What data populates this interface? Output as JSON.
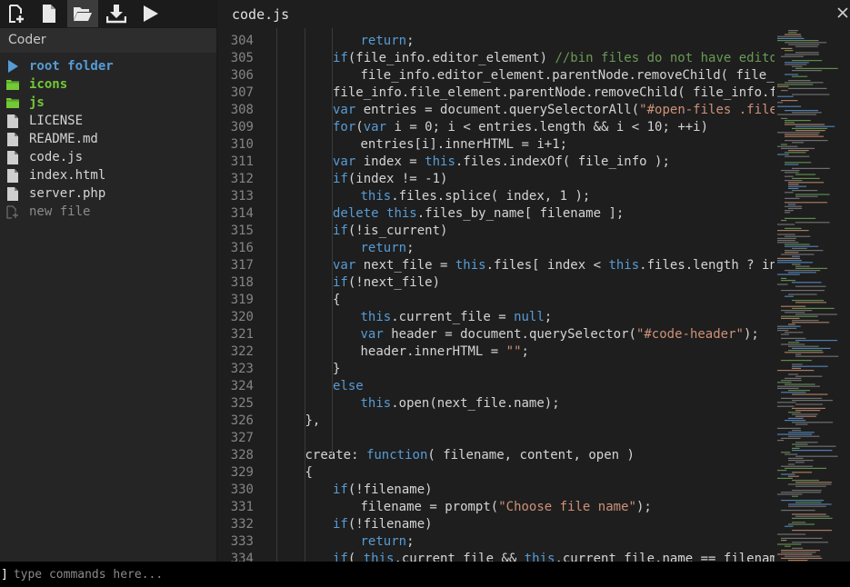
{
  "toolbar": {
    "buttons": [
      {
        "icon": "new-file-icon",
        "active": false
      },
      {
        "icon": "file-icon",
        "active": false
      },
      {
        "icon": "folder-open-icon",
        "active": true
      },
      {
        "icon": "download-icon",
        "active": false
      },
      {
        "icon": "play-icon",
        "active": false
      }
    ]
  },
  "sidebar": {
    "title": "Coder",
    "items": [
      {
        "label": "root folder",
        "type": "root",
        "icon": "triangle-right-icon"
      },
      {
        "label": "icons",
        "type": "folder",
        "icon": "folder-icon"
      },
      {
        "label": "js",
        "type": "folder",
        "icon": "folder-icon"
      },
      {
        "label": "LICENSE",
        "type": "file",
        "icon": "file-icon"
      },
      {
        "label": "README.md",
        "type": "file",
        "icon": "file-icon"
      },
      {
        "label": "code.js",
        "type": "file",
        "icon": "file-icon"
      },
      {
        "label": "index.html",
        "type": "file",
        "icon": "file-icon"
      },
      {
        "label": "server.php",
        "type": "file",
        "icon": "file-icon"
      },
      {
        "label": "new file",
        "type": "newfile",
        "icon": "new-file-icon"
      }
    ]
  },
  "editor": {
    "filename": "code.js",
    "lines": [
      {
        "n": "304",
        "indent": 3,
        "parts": [
          [
            "kw",
            "return"
          ],
          [
            "",
            "; "
          ]
        ]
      },
      {
        "n": "305",
        "indent": 2,
        "parts": [
          [
            "kw",
            "if"
          ],
          [
            "",
            "(file_info.editor_element) "
          ],
          [
            "cm",
            "//bin files do not have editor"
          ]
        ]
      },
      {
        "n": "306",
        "indent": 3,
        "parts": [
          [
            "",
            "file_info.editor_element.parentNode.removeChild( file_info."
          ]
        ]
      },
      {
        "n": "307",
        "indent": 2,
        "parts": [
          [
            "",
            "file_info.file_element.parentNode.removeChild( file_info.file_e"
          ]
        ]
      },
      {
        "n": "308",
        "indent": 2,
        "parts": [
          [
            "kw",
            "var"
          ],
          [
            "",
            " entries = document.querySelectorAll("
          ],
          [
            "str",
            "\"#open-files .filename"
          ]
        ]
      },
      {
        "n": "309",
        "indent": 2,
        "parts": [
          [
            "kw",
            "for"
          ],
          [
            "",
            "("
          ],
          [
            "kw",
            "var"
          ],
          [
            "",
            " i = 0; i < entries.length && i < 10; ++i)"
          ]
        ]
      },
      {
        "n": "310",
        "indent": 3,
        "parts": [
          [
            "",
            "entries[i].innerHTML = i+1;"
          ]
        ]
      },
      {
        "n": "311",
        "indent": 2,
        "parts": [
          [
            "kw",
            "var"
          ],
          [
            "",
            " index = "
          ],
          [
            "kw",
            "this"
          ],
          [
            "",
            ".files.indexOf( file_info );"
          ]
        ]
      },
      {
        "n": "312",
        "indent": 2,
        "parts": [
          [
            "kw",
            "if"
          ],
          [
            "",
            "(index != -1)"
          ]
        ]
      },
      {
        "n": "313",
        "indent": 3,
        "parts": [
          [
            "kw",
            "this"
          ],
          [
            "",
            ".files.splice( index, 1 );"
          ]
        ]
      },
      {
        "n": "314",
        "indent": 2,
        "parts": [
          [
            "kw",
            "delete"
          ],
          [
            "",
            " "
          ],
          [
            "kw",
            "this"
          ],
          [
            "",
            ".files_by_name[ filename ];"
          ]
        ]
      },
      {
        "n": "315",
        "indent": 2,
        "parts": [
          [
            "kw",
            "if"
          ],
          [
            "",
            "(!is_current)"
          ]
        ]
      },
      {
        "n": "316",
        "indent": 3,
        "parts": [
          [
            "kw",
            "return"
          ],
          [
            "",
            ";"
          ]
        ]
      },
      {
        "n": "317",
        "indent": 2,
        "parts": [
          [
            "kw",
            "var"
          ],
          [
            "",
            " next_file = "
          ],
          [
            "kw",
            "this"
          ],
          [
            "",
            ".files[ index < "
          ],
          [
            "kw",
            "this"
          ],
          [
            "",
            ".files.length ? index :"
          ]
        ]
      },
      {
        "n": "318",
        "indent": 2,
        "parts": [
          [
            "kw",
            "if"
          ],
          [
            "",
            "(!next_file)"
          ]
        ]
      },
      {
        "n": "319",
        "indent": 2,
        "parts": [
          [
            "",
            "{"
          ]
        ]
      },
      {
        "n": "320",
        "indent": 3,
        "parts": [
          [
            "kw",
            "this"
          ],
          [
            "",
            ".current_file = "
          ],
          [
            "kw",
            "null"
          ],
          [
            "",
            ";"
          ]
        ]
      },
      {
        "n": "321",
        "indent": 3,
        "parts": [
          [
            "kw",
            "var"
          ],
          [
            "",
            " header = document.querySelector("
          ],
          [
            "str",
            "\"#code-header\""
          ],
          [
            "",
            ");"
          ]
        ]
      },
      {
        "n": "322",
        "indent": 3,
        "parts": [
          [
            "",
            "header.innerHTML = "
          ],
          [
            "str",
            "\"\""
          ],
          [
            "",
            ";"
          ]
        ]
      },
      {
        "n": "323",
        "indent": 2,
        "parts": [
          [
            "",
            "}"
          ]
        ]
      },
      {
        "n": "324",
        "indent": 2,
        "parts": [
          [
            "kw",
            "else"
          ]
        ]
      },
      {
        "n": "325",
        "indent": 3,
        "parts": [
          [
            "kw",
            "this"
          ],
          [
            "",
            ".open(next_file.name);"
          ]
        ]
      },
      {
        "n": "326",
        "indent": 1,
        "parts": [
          [
            "",
            "},"
          ]
        ]
      },
      {
        "n": "327",
        "indent": 0,
        "parts": []
      },
      {
        "n": "328",
        "indent": 1,
        "parts": [
          [
            "",
            "create: "
          ],
          [
            "kw",
            "function"
          ],
          [
            "",
            "( filename, content, open )"
          ]
        ]
      },
      {
        "n": "329",
        "indent": 1,
        "parts": [
          [
            "",
            "{"
          ]
        ]
      },
      {
        "n": "330",
        "indent": 2,
        "parts": [
          [
            "kw",
            "if"
          ],
          [
            "",
            "(!filename)"
          ]
        ]
      },
      {
        "n": "331",
        "indent": 3,
        "parts": [
          [
            "",
            "filename = prompt("
          ],
          [
            "str",
            "\"Choose file name\""
          ],
          [
            "",
            ");"
          ]
        ]
      },
      {
        "n": "332",
        "indent": 2,
        "parts": [
          [
            "kw",
            "if"
          ],
          [
            "",
            "(!filename)"
          ]
        ]
      },
      {
        "n": "333",
        "indent": 3,
        "parts": [
          [
            "kw",
            "return"
          ],
          [
            "",
            ";"
          ]
        ]
      },
      {
        "n": "334",
        "indent": 2,
        "parts": [
          [
            "kw",
            "if"
          ],
          [
            "",
            "( "
          ],
          [
            "kw",
            "this"
          ],
          [
            "",
            ".current_file && "
          ],
          [
            "kw",
            "this"
          ],
          [
            "",
            ".current_file.name == filename )"
          ]
        ]
      }
    ]
  },
  "command": {
    "prompt": "]",
    "placeholder": "type commands here..."
  },
  "colors": {
    "keyword": "#569cd6",
    "string": "#ce9178",
    "comment": "#6a9955",
    "folder": "#73c936",
    "root": "#569cd6"
  }
}
